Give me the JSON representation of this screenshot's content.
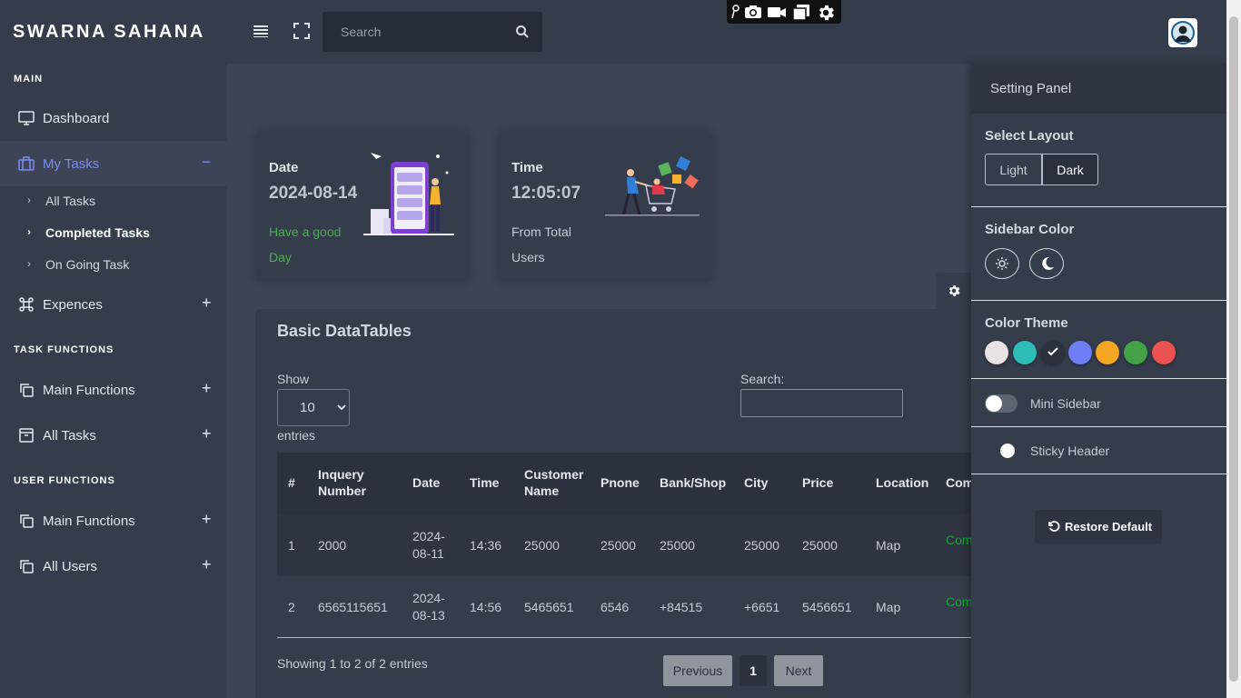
{
  "app": {
    "brand": "SWARNA SAHANA"
  },
  "header": {
    "search_placeholder": "Search",
    "icons": [
      "menu-icon",
      "fullscreen-icon",
      "search-icon",
      "user-avatar"
    ],
    "capture_icons": [
      "pin-icon",
      "camera-icon",
      "video-icon",
      "window-icon",
      "gear-icon"
    ]
  },
  "sidebar": {
    "sections": [
      {
        "title": "MAIN"
      },
      {
        "title": "TASK FUNCTIONS"
      },
      {
        "title": "USER FUNCTIONS"
      }
    ],
    "items": [
      {
        "label": "Dashboard",
        "icon": "monitor-icon"
      },
      {
        "label": "My Tasks",
        "icon": "briefcase-icon",
        "toggle": "−"
      },
      {
        "label": "Expences",
        "icon": "command-icon",
        "toggle": "+"
      },
      {
        "label": "Main Functions",
        "icon": "copy-icon",
        "toggle": "+"
      },
      {
        "label": "All Tasks",
        "icon": "archive-icon",
        "toggle": "+"
      },
      {
        "label": "Main Functions",
        "icon": "copy-icon",
        "toggle": "+"
      },
      {
        "label": "All Users",
        "icon": "copy-icon",
        "toggle": "+"
      }
    ],
    "subitems": [
      {
        "label": "All Tasks"
      },
      {
        "label": "Completed Tasks"
      },
      {
        "label": "On Going Task"
      }
    ]
  },
  "cards": {
    "date": {
      "title": "Date",
      "value": "2024-08-14",
      "sub1": "Have a good",
      "sub2": "Day"
    },
    "time": {
      "title": "Time",
      "value": "12:05:07",
      "sub1": "From Total",
      "sub2": "Users"
    }
  },
  "table_card": {
    "title": "Basic DataTables",
    "show_label": "Show",
    "entries_value": "10",
    "entries_label": "entries",
    "search_label": "Search:",
    "columns": [
      {
        "l1": "#",
        "l2": ""
      },
      {
        "l1": "Inquery",
        "l2": "Number"
      },
      {
        "l1": "Date",
        "l2": ""
      },
      {
        "l1": "Time",
        "l2": ""
      },
      {
        "l1": "Customer",
        "l2": "Name"
      },
      {
        "l1": "Pnone",
        "l2": ""
      },
      {
        "l1": "Bank/Shop",
        "l2": ""
      },
      {
        "l1": "City",
        "l2": ""
      },
      {
        "l1": "Price",
        "l2": ""
      },
      {
        "l1": "Location",
        "l2": ""
      },
      {
        "l1": "Com",
        "l2": ""
      }
    ],
    "rows": [
      {
        "no": "1",
        "inq": "2000",
        "date1": "2024-",
        "date2": "08-11",
        "time": "14:36",
        "cust": "25000",
        "phone": "25000",
        "bank": "25000",
        "city": "25000",
        "price": "25000",
        "loc": "Map",
        "status": "Com"
      },
      {
        "no": "2",
        "inq": "6565115651",
        "date1": "2024-",
        "date2": "08-13",
        "time": "14:56",
        "cust": "5465651",
        "phone": "6546",
        "bank": "+84515",
        "city": "+6651",
        "price": "5456651",
        "loc": "Map",
        "status": "Com"
      }
    ],
    "info": "Showing 1 to 2 of 2 entries",
    "pagination": {
      "prev": "Previous",
      "page": "1",
      "next": "Next"
    }
  },
  "panel": {
    "title": "Setting Panel",
    "layout_title": "Select Layout",
    "layout_light": "Light",
    "layout_dark": "Dark",
    "sidebar_color_title": "Sidebar Color",
    "color_theme_title": "Color Theme",
    "swatches": [
      "#e8e2e2",
      "#2dbdb6",
      "#2b313e",
      "#6f7ef5",
      "#f5a623",
      "#43a047",
      "#ea5252"
    ],
    "mini_sidebar": "Mini Sidebar",
    "sticky_header": "Sticky Header",
    "restore": "Restore Default"
  },
  "colors": {
    "accent": "#7b8cf0",
    "success": "#4caf50",
    "status": "#1f9f3d"
  }
}
